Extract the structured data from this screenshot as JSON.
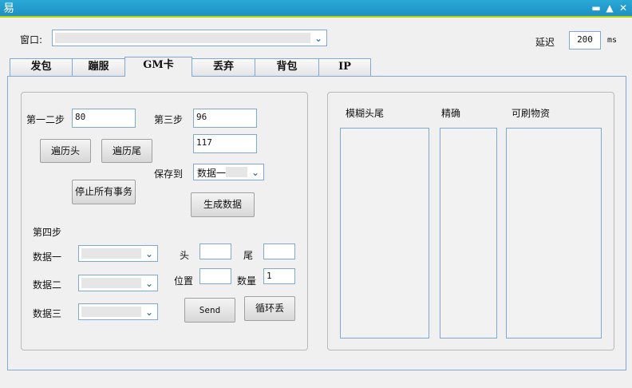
{
  "titlebar": {
    "icon_glyph": "易",
    "min_glyph": "▬",
    "max_glyph": "▲",
    "close_glyph": "✕"
  },
  "window": {
    "label": "窗口:"
  },
  "delay": {
    "label": "延迟",
    "value": "200",
    "unit": "ms"
  },
  "tabs": [
    {
      "label": "发包"
    },
    {
      "label": "蹦服"
    },
    {
      "label": "GM卡"
    },
    {
      "label": "丢弃"
    },
    {
      "label": "背包"
    },
    {
      "label": "IP"
    }
  ],
  "steps": {
    "step12_label": "第一二步",
    "step12_value": "80",
    "step3_label": "第三步",
    "step3_value1": "96",
    "step3_value2": "117",
    "traverse_head": "遍历头",
    "traverse_tail": "遍历尾",
    "save_to_label": "保存到",
    "save_to_value": "数据一",
    "stop_all": "停止所有事务",
    "generate": "生成数据",
    "step4_label": "第四步",
    "data1_label": "数据一",
    "data2_label": "数据二",
    "data3_label": "数据三",
    "head_label": "头",
    "tail_label": "尾",
    "position_label": "位置",
    "quantity_label": "数量",
    "quantity_value": "1",
    "send": "Send",
    "loop_drop": "循环丢"
  },
  "results": {
    "fuzzy_tail": "模糊头尾",
    "exact": "精确",
    "brushable": "可刷物资"
  }
}
